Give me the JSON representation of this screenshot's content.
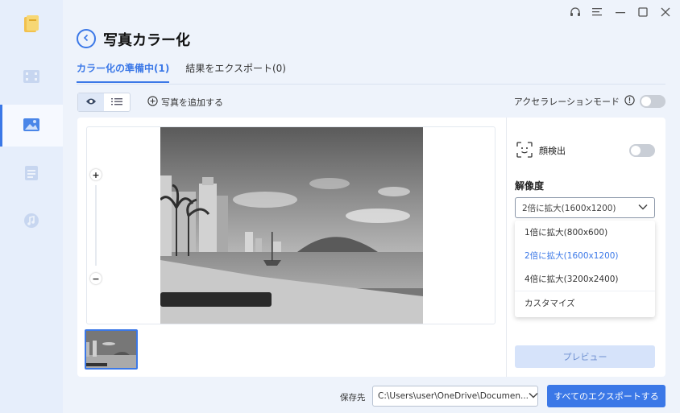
{
  "app": {
    "title": "写真カラー化",
    "window_controls": [
      "headset-icon",
      "menu-icon",
      "minimize-icon",
      "maximize-icon",
      "close-icon"
    ]
  },
  "sidebar": {
    "items": [
      {
        "name": "video",
        "icon": "film-icon",
        "active": false
      },
      {
        "name": "photo",
        "icon": "image-icon",
        "active": true
      },
      {
        "name": "document",
        "icon": "document-icon",
        "active": false
      },
      {
        "name": "audio",
        "icon": "music-icon",
        "active": false
      }
    ]
  },
  "tabs": [
    {
      "label": "カラー化の準備中(1)",
      "active": true
    },
    {
      "label": "結果をエクスポート(0)",
      "active": false
    }
  ],
  "toolbar": {
    "add_photo_label": "写真を追加する",
    "accel_label": "アクセラレーションモード",
    "accel_on": false
  },
  "panel": {
    "face_label": "顔検出",
    "face_on": false,
    "resolution_label": "解像度",
    "selected": "2倍に拡大(1600x1200)",
    "options": [
      "1倍に拡大(800x600)",
      "2倍に拡大(1600x1200)",
      "4倍に拡大(3200x2400)",
      "カスタマイズ"
    ],
    "preview_label": "プレビュー"
  },
  "footer": {
    "save_label": "保存先",
    "path": "C:\\Users\\user\\OneDrive\\Documen...",
    "export_label": "すべてのエクスポートする"
  },
  "colors": {
    "accent": "#3b78e7",
    "rail": "#e6eefb",
    "background": "#eef3fb"
  }
}
